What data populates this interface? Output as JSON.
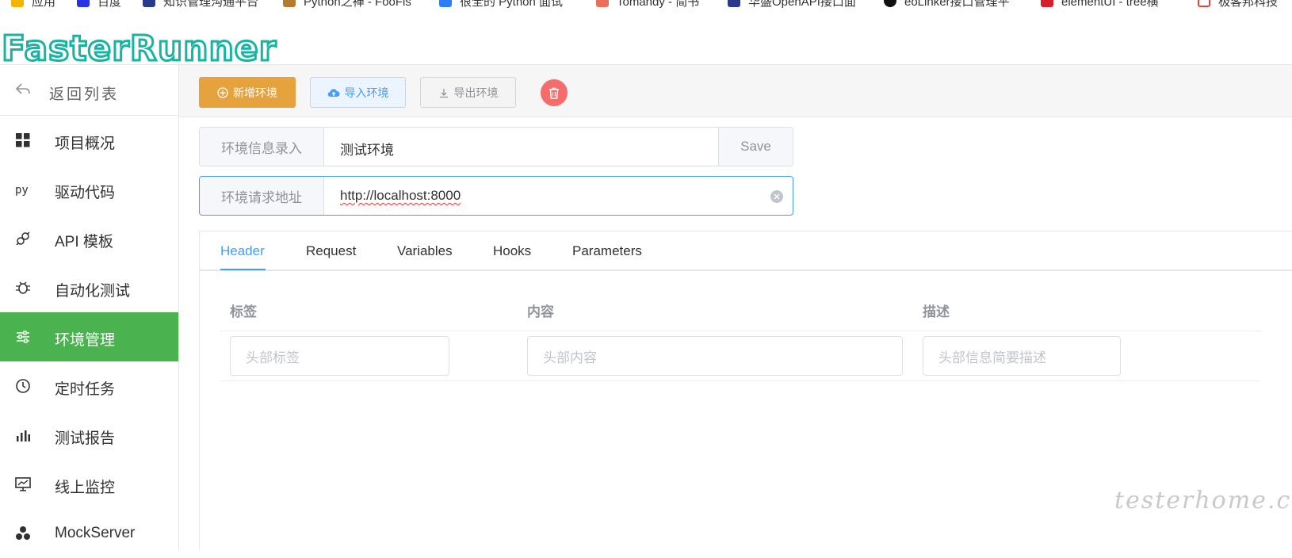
{
  "bookmarks": [
    {
      "label": "应用",
      "color": "#f4b400"
    },
    {
      "label": "百度",
      "color": "#2932e1"
    },
    {
      "label": "知识管理沟通平台",
      "color": "#2a3a8a"
    },
    {
      "label": "Python之禅 - FooFis",
      "color": "#b47b2e"
    },
    {
      "label": "很全的 Python 面试",
      "color": "#2b7ef5"
    },
    {
      "label": "Tomandy - 简书",
      "color": "#ea6f5a"
    },
    {
      "label": "华盛OpenAPI接口面",
      "color": "#2a3a8a"
    },
    {
      "label": "eoLinker接口管理平",
      "color": "#111111"
    },
    {
      "label": "elementUI - tree横",
      "color": "#d4202a"
    },
    {
      "label": "极客邦科技",
      "color": "#e8433a"
    }
  ],
  "app": {
    "logo_text": "FasterRunner",
    "logo_color": "#17b3a3"
  },
  "sidebar": {
    "back_label": "返回列表",
    "items": [
      {
        "label": "项目概况",
        "icon": "grid-icon"
      },
      {
        "label": "驱动代码",
        "icon": "py-icon"
      },
      {
        "label": "API 模板",
        "icon": "link-icon"
      },
      {
        "label": "自动化测试",
        "icon": "bug-icon"
      },
      {
        "label": "环境管理",
        "icon": "sliders-icon",
        "active": true
      },
      {
        "label": "定时任务",
        "icon": "clock-icon"
      },
      {
        "label": "测试报告",
        "icon": "bar-chart-icon"
      },
      {
        "label": "线上监控",
        "icon": "monitor-icon"
      },
      {
        "label": "MockServer",
        "icon": "cluster-icon"
      }
    ],
    "active_color": "#4ab350"
  },
  "toolbar": {
    "add_label": "新增环境",
    "import_label": "导入环境",
    "export_label": "导出环境"
  },
  "form": {
    "env_info_label": "环境信息录入",
    "env_name_value": "测试环境",
    "save_label": "Save",
    "env_url_label": "环境请求地址",
    "env_url_value": "http://localhost:8000"
  },
  "tabs": [
    "Header",
    "Request",
    "Variables",
    "Hooks",
    "Parameters"
  ],
  "header_table": {
    "columns": [
      "标签",
      "内容",
      "描述"
    ],
    "placeholders": [
      "头部标签",
      "头部内容",
      "头部信息简要描述"
    ]
  },
  "watermark": "testerhome.com"
}
